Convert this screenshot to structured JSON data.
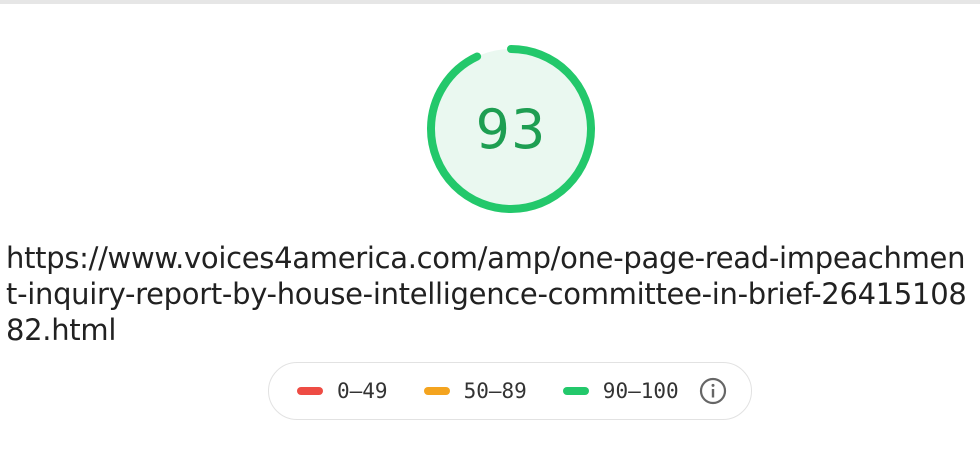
{
  "report": {
    "score": "93",
    "score_fraction": 0.93,
    "url": "https://www.voices4america.com/amp/one-page-read-impeachment-inquiry-report-by-house-intelligence-committee-in-brief-2641510882.html"
  },
  "colors": {
    "pass": "#23c86b",
    "pass_text": "#1e9e52",
    "pass_bg": "#eaf8f0",
    "average": "#f4a41f",
    "fail": "#ee4c44"
  },
  "legend": {
    "items": [
      {
        "label": "0–49",
        "color": "#ee4c44"
      },
      {
        "label": "50–89",
        "color": "#f4a41f"
      },
      {
        "label": "90–100",
        "color": "#23c86b"
      }
    ],
    "info_icon": "info-icon"
  }
}
